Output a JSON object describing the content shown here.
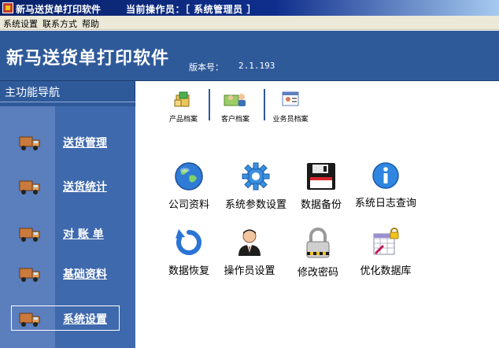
{
  "window": {
    "title": "新马送货单打印软件",
    "operator_label": "当前操作员：［ 系统管理员 ］"
  },
  "menu": {
    "items": [
      "系统设置",
      "联系方式",
      "帮助"
    ]
  },
  "banner": {
    "title": "新马送货单打印软件",
    "version_label": "版本号：",
    "version_value": "2.1.193"
  },
  "sidebar": {
    "header": "主功能导航",
    "items": [
      {
        "label": "送货管理",
        "icon": "truck-icon"
      },
      {
        "label": "送货统计",
        "icon": "truck-icon"
      },
      {
        "label": "对 账 单",
        "icon": "truck-icon"
      },
      {
        "label": "基础资料",
        "icon": "truck-icon"
      },
      {
        "label": "系统设置",
        "icon": "truck-icon",
        "selected": true
      }
    ]
  },
  "quick_access": [
    {
      "label": "产品档案",
      "icon": "product-archive-icon"
    },
    {
      "label": "客户档案",
      "icon": "customer-archive-icon"
    },
    {
      "label": "业务员档案",
      "icon": "salesperson-archive-icon"
    }
  ],
  "tools": [
    {
      "label": "公司资料",
      "icon": "globe-icon"
    },
    {
      "label": "系统参数设置",
      "icon": "gear-icon"
    },
    {
      "label": "数据备份",
      "icon": "floppy-disk-icon"
    },
    {
      "label": "系统日志查询",
      "icon": "info-icon"
    },
    {
      "label": "数据恢复",
      "icon": "restore-arrow-icon"
    },
    {
      "label": "操作员设置",
      "icon": "operator-person-icon"
    },
    {
      "label": "修改密码",
      "icon": "padlock-icon"
    },
    {
      "label": "优化数据库",
      "icon": "database-optimize-icon"
    }
  ],
  "colors": {
    "banner": "#2f5a9a",
    "sidebar_left": "#5b7ebd",
    "sidebar_right": "#3f69ad"
  }
}
